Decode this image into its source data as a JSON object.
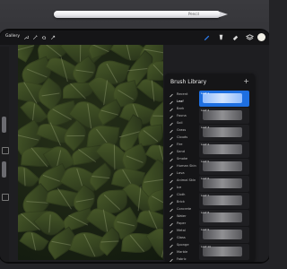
{
  "toolbar": {
    "gallery_label": "Gallery",
    "left_tools": [
      "wrench-icon",
      "magic-wand-icon",
      "selection-icon",
      "transform-arrow-icon"
    ],
    "right_tools": [
      "brush-icon",
      "smudge-icon",
      "eraser-icon",
      "layers-icon"
    ],
    "color": "#f1efe6"
  },
  "pencil": {
    "brand": "Pencil"
  },
  "brush_library": {
    "title": "Brush Library",
    "categories": [
      {
        "label": "Recent",
        "active": false
      },
      {
        "label": "Leaf",
        "active": true
      },
      {
        "label": "Bark",
        "active": false
      },
      {
        "label": "Fauna",
        "active": false
      },
      {
        "label": "Soil",
        "active": false
      },
      {
        "label": "Grass",
        "active": false
      },
      {
        "label": "Clouds",
        "active": false
      },
      {
        "label": "Fire",
        "active": false
      },
      {
        "label": "Sand",
        "active": false
      },
      {
        "label": "Smoke",
        "active": false
      },
      {
        "label": "Human Skin",
        "active": false
      },
      {
        "label": "Lava",
        "active": false
      },
      {
        "label": "Animal Skin",
        "active": false
      },
      {
        "label": "Ice",
        "active": false
      },
      {
        "label": "Cloth",
        "active": false
      },
      {
        "label": "Brick",
        "active": false
      },
      {
        "label": "Concrete",
        "active": false
      },
      {
        "label": "Water",
        "active": false
      },
      {
        "label": "Paper",
        "active": false
      },
      {
        "label": "Metal",
        "active": false
      },
      {
        "label": "Glass",
        "active": false
      },
      {
        "label": "Sponge",
        "active": false
      },
      {
        "label": "Marble",
        "active": false
      },
      {
        "label": "Fabric",
        "active": false
      }
    ],
    "brushes": [
      {
        "label": "Leaf 1",
        "active": true
      },
      {
        "label": "Leaf 2",
        "active": false
      },
      {
        "label": "Leaf 3",
        "active": false
      },
      {
        "label": "Leaf 4",
        "active": false
      },
      {
        "label": "Leaf 5",
        "active": false
      },
      {
        "label": "Leaf 6",
        "active": false
      },
      {
        "label": "Leaf 7",
        "active": false
      },
      {
        "label": "Leaf 8",
        "active": false
      },
      {
        "label": "Leaf 9",
        "active": false
      },
      {
        "label": "Leaf 10",
        "active": false
      }
    ]
  }
}
